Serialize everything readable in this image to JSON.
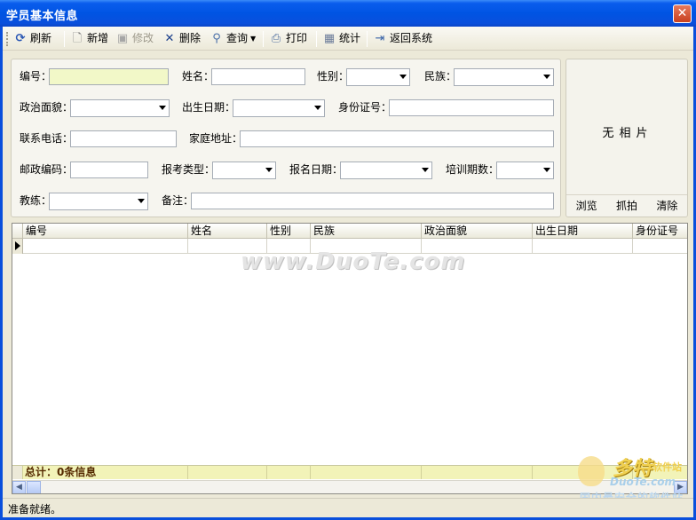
{
  "window": {
    "title": "学员基本信息",
    "close_glyph": "✕"
  },
  "toolbar": {
    "refresh": "刷新",
    "add": "新增",
    "edit": "修改",
    "delete": "删除",
    "query": "查询",
    "print": "打印",
    "stats": "统计",
    "back": "返回系统",
    "icons": [
      "refresh-icon",
      "new-doc-icon",
      "edit-icon",
      "delete-x-icon",
      "magnifier-icon",
      "printer-icon",
      "stats-icon",
      "exit-icon"
    ]
  },
  "form": {
    "id_label": "编号：",
    "name_label": "姓名：",
    "gender_label": "性别：",
    "ethnic_label": "民族：",
    "politics_label": "政治面貌：",
    "birth_label": "出生日期：",
    "idcard_label": "身份证号：",
    "phone_label": "联系电话：",
    "address_label": "家庭地址：",
    "postcode_label": "邮政编码：",
    "examtype_label": "报考类型：",
    "regdate_label": "报名日期：",
    "period_label": "培训期数：",
    "coach_label": "教练：",
    "remark_label": "备注：",
    "values": {
      "id": "",
      "name": "",
      "gender": "",
      "ethnic": "",
      "politics": "",
      "birth": "",
      "idcard": "",
      "phone": "",
      "address": "",
      "postcode": "",
      "examtype": "",
      "regdate": "",
      "period": "",
      "coach": "",
      "remark": ""
    }
  },
  "photo": {
    "placeholder": "无相片",
    "browse": "浏览",
    "capture": "抓拍",
    "clear": "清除"
  },
  "grid": {
    "columns": [
      "编号",
      "姓名",
      "性别",
      "民族",
      "政治面貌",
      "出生日期",
      "身份证号"
    ],
    "rows": [
      [
        "",
        "",
        "",
        "",
        "",
        "",
        ""
      ]
    ],
    "footer": "总计：0条信息"
  },
  "watermark": {
    "text": "www.DuoTe.com",
    "logo_line1": "多特",
    "logo_line1b": "软件站",
    "logo_line2": "DuoTe.com",
    "logo_line3": "国内最安全的软件站"
  },
  "status": {
    "text": "准备就绪。"
  },
  "colors": {
    "titlebar": "#0054e3",
    "highlight_input": "#f2f8c8",
    "footer": "#f2f3b8",
    "face": "#ece9d8"
  }
}
